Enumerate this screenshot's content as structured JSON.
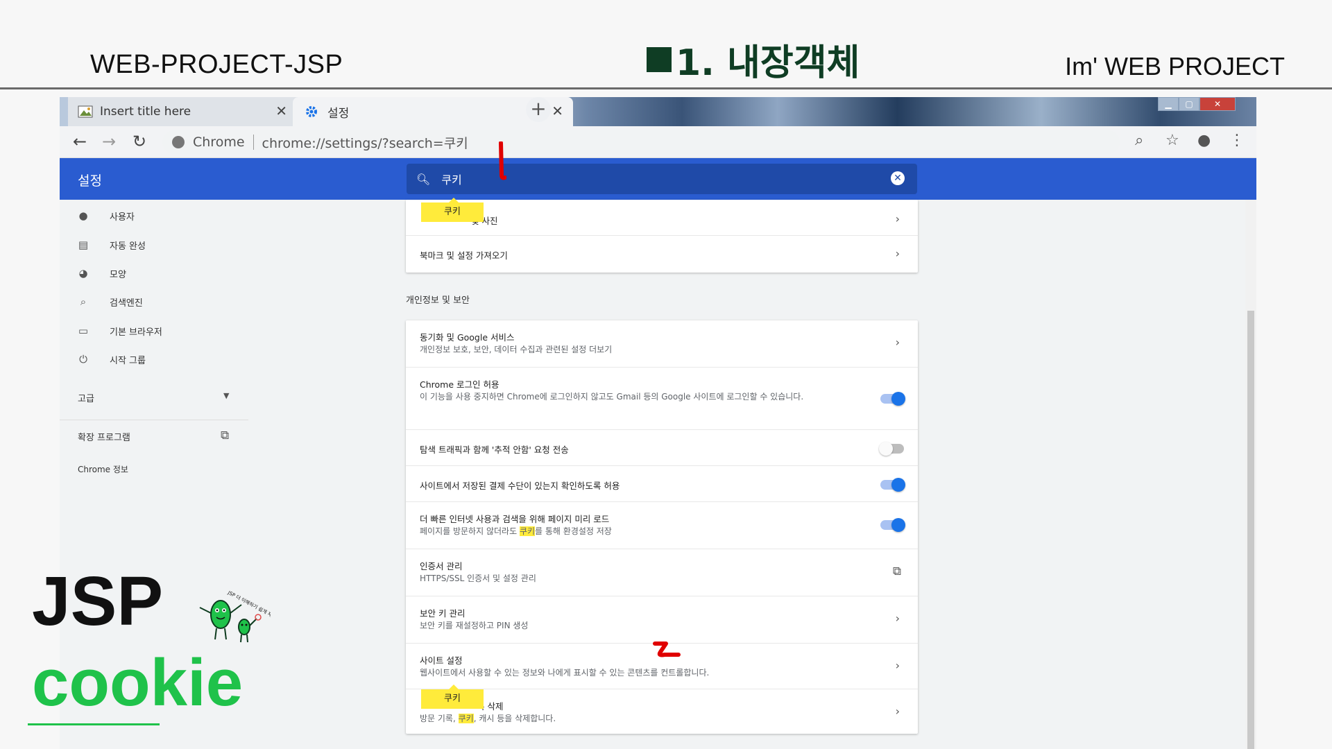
{
  "slide": {
    "left_title": "WEB-PROJECT-JSP",
    "center_title": "1. 내장객체",
    "right_title": "Im'  WEB PROJECT",
    "caption_line1": "JSP",
    "caption_line2": "cookie",
    "mascot_text": "JSP 더 이해하기 쉽게 재밌게!"
  },
  "browser": {
    "tabs": [
      {
        "title": "Insert title here",
        "icon": "image-icon"
      },
      {
        "title": "설정",
        "icon": "gear-icon"
      }
    ],
    "omnibox": {
      "site": "Chrome",
      "url": "chrome://settings/?search=쿠키"
    }
  },
  "settings": {
    "header_title": "설정",
    "search_value": "쿠키",
    "sidebar": [
      {
        "label": "사용자",
        "icon": "person-icon"
      },
      {
        "label": "자동 완성",
        "icon": "clipboard-icon"
      },
      {
        "label": "모양",
        "icon": "palette-icon"
      },
      {
        "label": "검색엔진",
        "icon": "search-icon"
      },
      {
        "label": "기본 브라우저",
        "icon": "browser-icon"
      },
      {
        "label": "시작 그룹",
        "icon": "power-icon"
      }
    ],
    "advanced_label": "고급",
    "extensions_label": "확장 프로그램",
    "about_label": "Chrome 정보",
    "card1": [
      {
        "title_tail": "및 사진",
        "bubble": "쿠키"
      },
      {
        "title": "북마크 및 설정 가져오기"
      }
    ],
    "section_label": "개인정보 및 보안",
    "rows": [
      {
        "title": "동기화 및 Google 서비스",
        "sub": "개인정보 보호, 보안, 데이터 수집과 관련된 설정 더보기",
        "control": "chevron"
      },
      {
        "title": "Chrome 로그인 허용",
        "sub": "이 기능을 사용 중지하면 Chrome에 로그인하지 않고도 Gmail 등의 Google 사이트에 로그인할 수 있습니다.",
        "control": "toggle-on"
      },
      {
        "title": "탐색 트래픽과 함께 '추적 안함' 요청 전송",
        "control": "toggle-off"
      },
      {
        "title": "사이트에서 저장된 결제 수단이 있는지 확인하도록 허용",
        "control": "toggle-on"
      },
      {
        "title": "더 빠른 인터넷 사용과 검색을 위해 페이지 미리 로드",
        "sub_pre": "페이지를 방문하지 않더라도 ",
        "sub_hl": "쿠키",
        "sub_post": "를 통해 환경설정 저장",
        "control": "toggle-on"
      },
      {
        "title": "인증서 관리",
        "sub": "HTTPS/SSL 인증서 및 설정 관리",
        "control": "external"
      },
      {
        "title": "보안 키 관리",
        "sub": "보안 키를 재설정하고 PIN 생성",
        "control": "chevron"
      },
      {
        "title": "사이트 설정",
        "sub": "웹사이트에서 사용할 수 있는 정보와 나에게 표시할 수 있는 콘텐츠를 컨트롤합니다.",
        "control": "chevron"
      },
      {
        "title_tail": "록 삭제",
        "bubble": "쿠키",
        "sub_pre": "방문 기록, ",
        "sub_hl": "쿠키",
        "sub_post": ", 캐시 등을 삭제합니다.",
        "control": "chevron"
      }
    ]
  },
  "colors": {
    "settings_blue": "#2a5cd0",
    "toggle_blue": "#1a73e8",
    "highlight_yellow": "#ffeb3b",
    "title_green": "#0f3d24",
    "cookie_green": "#1fc24a",
    "annotation_red": "#e00000"
  }
}
